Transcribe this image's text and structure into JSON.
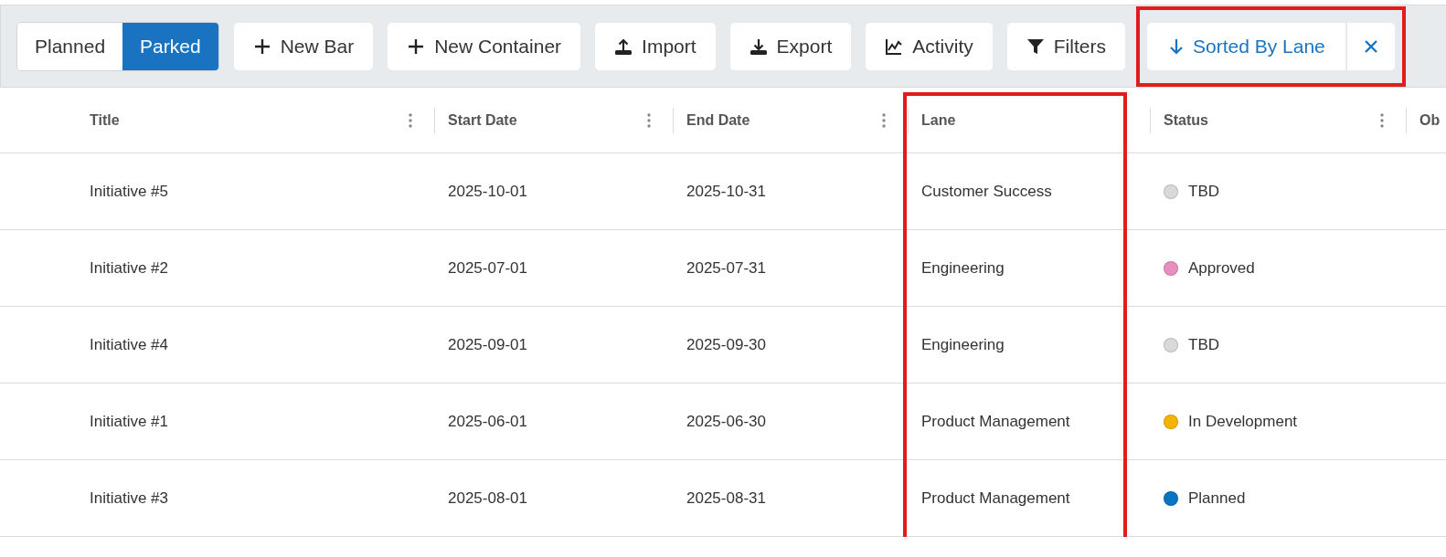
{
  "view_toggle": [
    {
      "label": "Planned",
      "selected": false
    },
    {
      "label": "Parked",
      "selected": true
    }
  ],
  "toolbar": [
    {
      "label": "New Bar",
      "kind": "add"
    },
    {
      "label": "New Container",
      "kind": "add"
    },
    {
      "label": "Import",
      "kind": "import"
    },
    {
      "label": "Export",
      "kind": "export"
    },
    {
      "label": "Activity",
      "kind": "activity"
    },
    {
      "label": "Filters",
      "kind": "filter"
    }
  ],
  "sort": {
    "label": "Sorted By Lane",
    "highlighted": true
  },
  "table": {
    "columns": [
      {
        "label": "Title",
        "menu": true,
        "highlighted": false
      },
      {
        "label": "Start Date",
        "menu": true,
        "highlighted": false
      },
      {
        "label": "End Date",
        "menu": true,
        "highlighted": false
      },
      {
        "label": "Lane",
        "menu": false,
        "highlighted": true
      },
      {
        "label": "Status",
        "menu": true,
        "highlighted": false
      },
      {
        "label": "Ob",
        "menu": false,
        "highlighted": false
      }
    ],
    "rows": [
      {
        "cells": [
          "Initiative #5",
          "2025-10-01",
          "2025-10-31",
          "Customer Success"
        ],
        "status": {
          "label": "TBD",
          "color": "#d9d9d9"
        }
      },
      {
        "cells": [
          "Initiative #2",
          "2025-07-01",
          "2025-07-31",
          "Engineering"
        ],
        "status": {
          "label": "Approved",
          "color": "#e88fc0"
        }
      },
      {
        "cells": [
          "Initiative #4",
          "2025-09-01",
          "2025-09-30",
          "Engineering"
        ],
        "status": {
          "label": "TBD",
          "color": "#d9d9d9"
        }
      },
      {
        "cells": [
          "Initiative #1",
          "2025-06-01",
          "2025-06-30",
          "Product Management"
        ],
        "status": {
          "label": "In Development",
          "color": "#f5b400"
        }
      },
      {
        "cells": [
          "Initiative #3",
          "2025-08-01",
          "2025-08-31",
          "Product Management"
        ],
        "status": {
          "label": "Planned",
          "color": "#0a74c4"
        }
      }
    ]
  }
}
